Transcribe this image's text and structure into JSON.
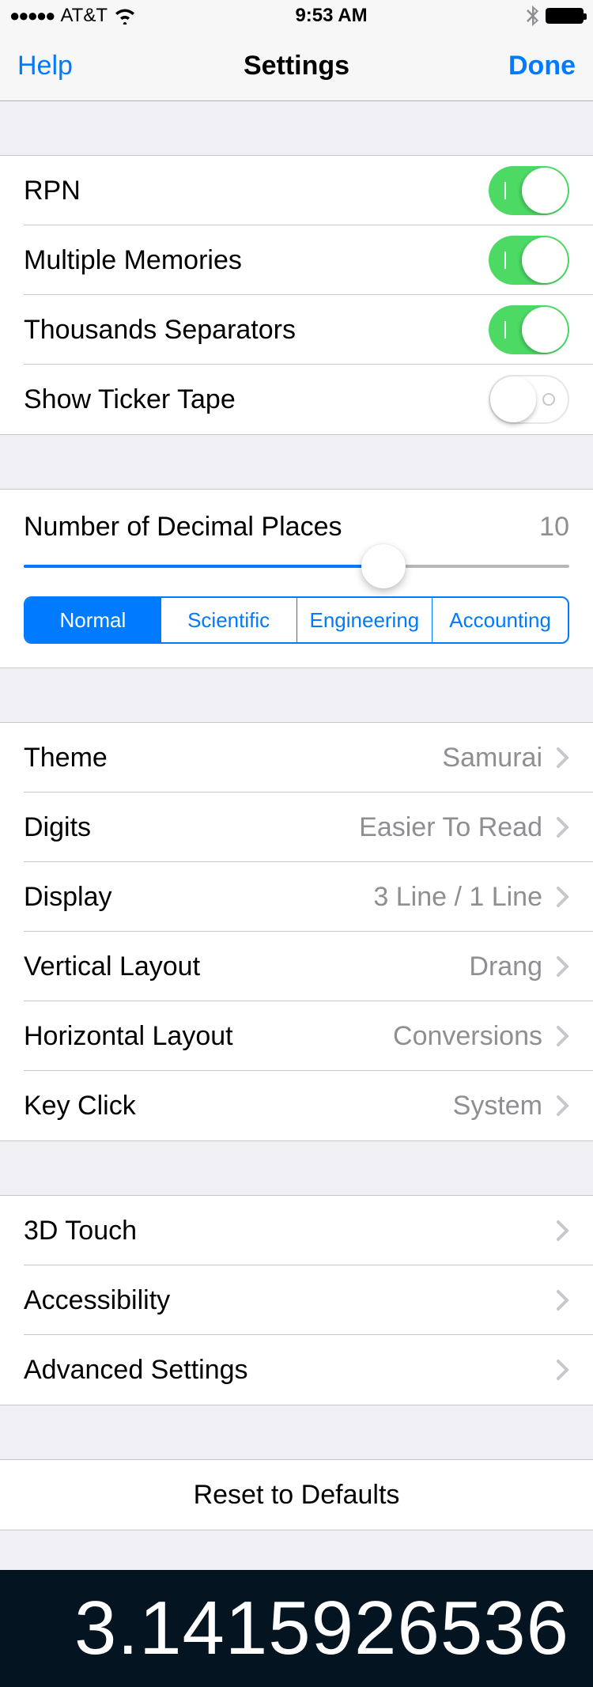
{
  "status": {
    "signal": "●●●●●",
    "carrier": "AT&T",
    "time": "9:53 AM"
  },
  "nav": {
    "left": "Help",
    "title": "Settings",
    "right": "Done"
  },
  "toggles": {
    "rpn": "RPN",
    "memories": "Multiple Memories",
    "thousands": "Thousands Separators",
    "ticker": "Show Ticker Tape"
  },
  "decimal": {
    "label": "Number of Decimal Places",
    "value": "10",
    "segments": {
      "normal": "Normal",
      "scientific": "Scientific",
      "engineering": "Engineering",
      "accounting": "Accounting"
    }
  },
  "prefs": {
    "theme_label": "Theme",
    "theme_value": "Samurai",
    "digits_label": "Digits",
    "digits_value": "Easier To Read",
    "display_label": "Display",
    "display_value": "3 Line / 1 Line",
    "vlayout_label": "Vertical Layout",
    "vlayout_value": "Drang",
    "hlayout_label": "Horizontal Layout",
    "hlayout_value": "Conversions",
    "keyclick_label": "Key Click",
    "keyclick_value": "System"
  },
  "more": {
    "touch3d": "3D Touch",
    "accessibility": "Accessibility",
    "advanced": "Advanced Settings"
  },
  "reset": "Reset to Defaults",
  "display_value": "3.1415926536"
}
